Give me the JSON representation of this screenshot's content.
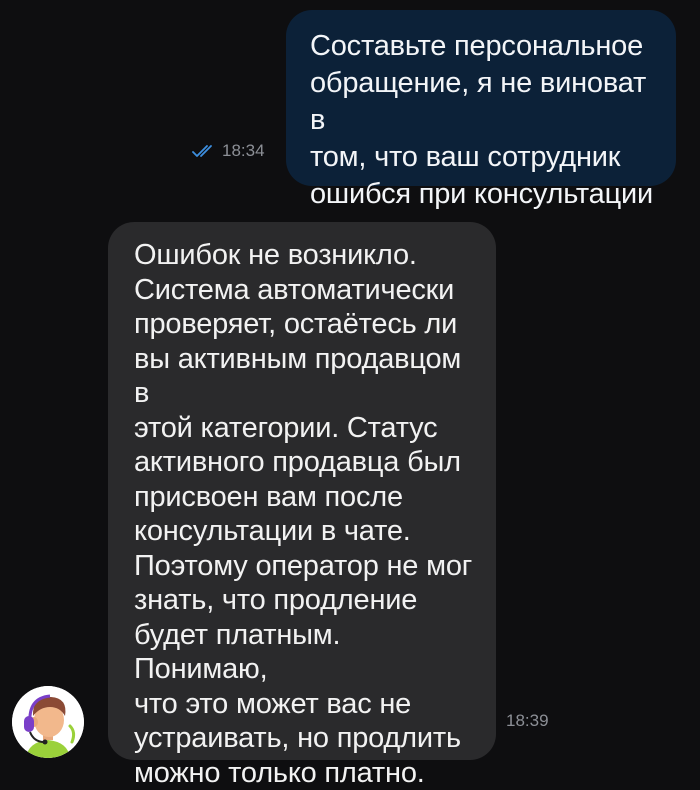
{
  "messages": {
    "outgoing": {
      "text": "Составьте персональное\nобращение, я не виноват в\nтом, что ваш сотрудник\nошибся при консультации",
      "time": "18:34",
      "status_icon": "double-check-icon",
      "bubble_color": "#0c2138",
      "check_color": "#3d8fe0"
    },
    "incoming": {
      "text": "Ошибок не возникло.\nСистема автоматически\nпроверяет, остаётесь ли\nвы активным продавцом в\nэтой категории. Статус\nактивного продавца был\nприсвоен вам после\nконсультации в чате.\nПоэтому оператор не мог\nзнать, что продление\nбудет платным. Понимаю,\nчто это может вас не\nустраивать, но продлить\nможно только платно.",
      "time": "18:39",
      "bubble_color": "#2a2a2c",
      "avatar_icon": "support-operator-avatar"
    }
  },
  "colors": {
    "background": "#0e0e10",
    "meta_text": "#8c8f96"
  }
}
